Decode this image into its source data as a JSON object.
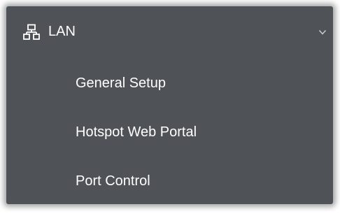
{
  "menu": {
    "section": {
      "label": "LAN",
      "icon": "network-icon",
      "expand_icon": "chevron-down-icon"
    },
    "items": [
      {
        "label": "General Setup"
      },
      {
        "label": "Hotspot Web Portal"
      },
      {
        "label": "Port Control"
      }
    ]
  },
  "colors": {
    "panel_background": "#4f5257",
    "text": "#ffffff"
  }
}
